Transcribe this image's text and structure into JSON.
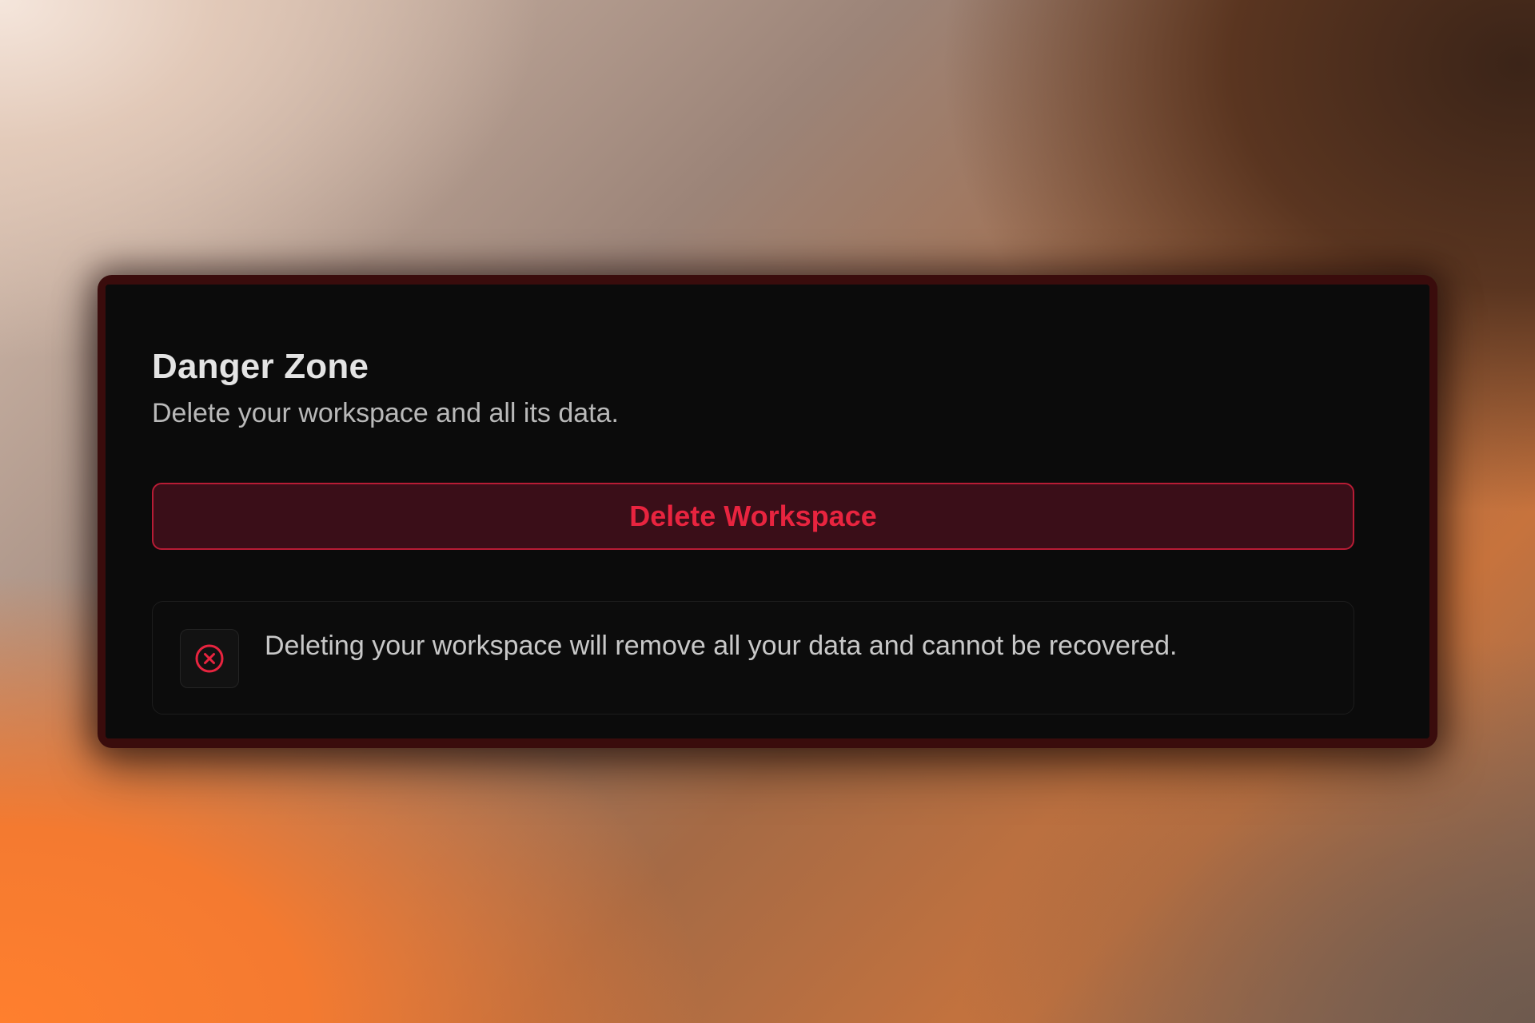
{
  "danger_zone": {
    "title": "Danger Zone",
    "subtitle": "Delete your workspace and all its data.",
    "delete_button_label": "Delete Workspace",
    "warning": {
      "icon": "x-circle-icon",
      "text": "Deleting your workspace will remove all your data and cannot be recovered."
    }
  },
  "colors": {
    "danger_accent": "#e8243f",
    "danger_border": "#b71c35",
    "danger_bg": "#3a0e18",
    "card_bg": "#0b0b0b"
  }
}
